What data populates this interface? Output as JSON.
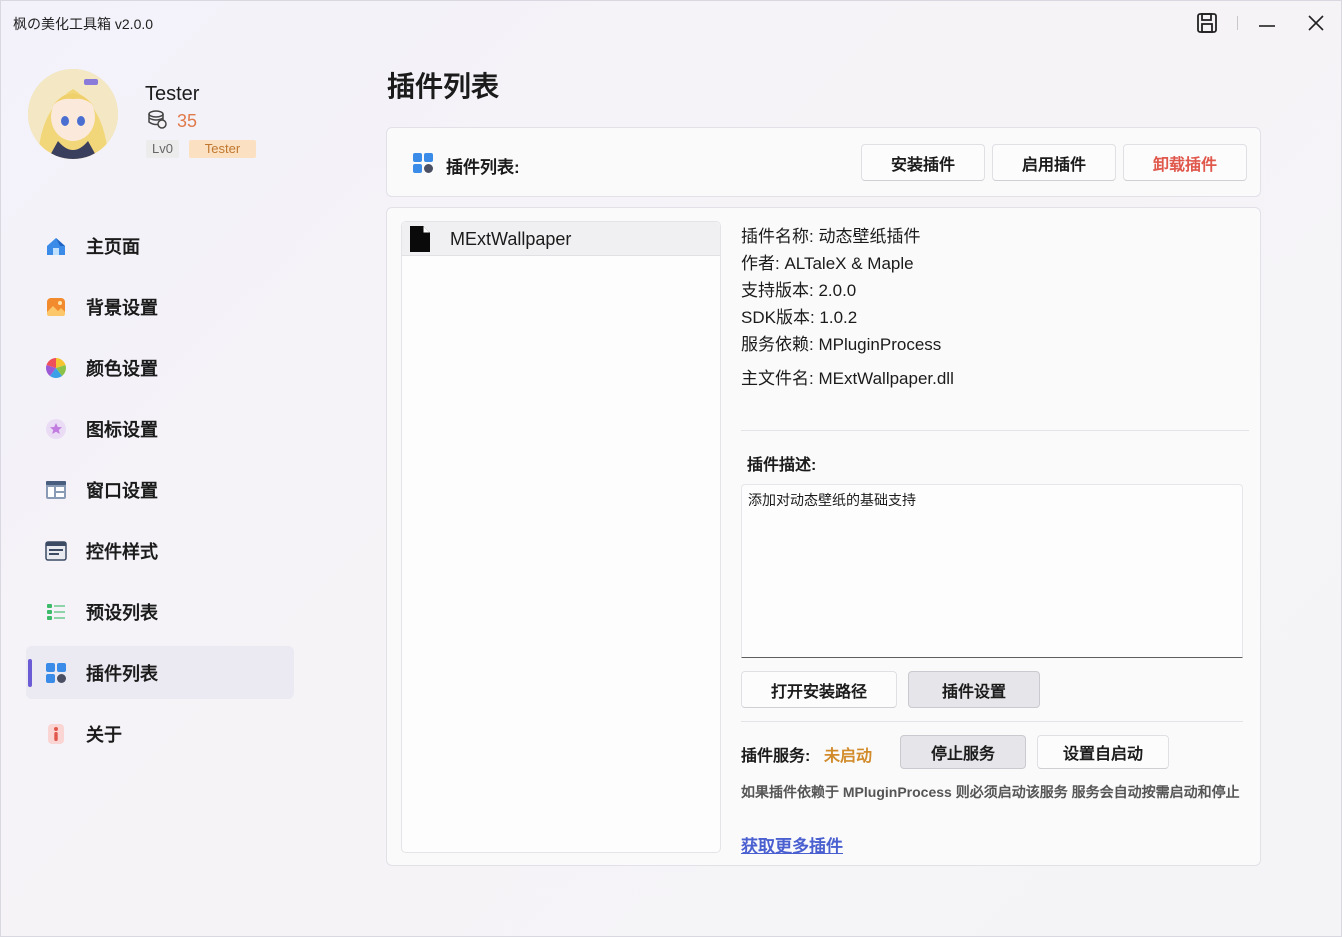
{
  "window": {
    "title": "枫の美化工具箱 v2.0.0",
    "buttons": [
      "save-icon",
      "minimize-icon",
      "close-icon"
    ]
  },
  "profile": {
    "username": "Tester",
    "coins": "35",
    "level": "Lv0",
    "role": "Tester"
  },
  "sidebar": {
    "items": [
      {
        "label": "主页面",
        "icon": "home-icon"
      },
      {
        "label": "背景设置",
        "icon": "image-icon"
      },
      {
        "label": "颜色设置",
        "icon": "color-wheel-icon"
      },
      {
        "label": "图标设置",
        "icon": "star-icon"
      },
      {
        "label": "窗口设置",
        "icon": "window-icon"
      },
      {
        "label": "控件样式",
        "icon": "control-icon"
      },
      {
        "label": "预设列表",
        "icon": "list-icon"
      },
      {
        "label": "插件列表",
        "icon": "plugin-grid-icon",
        "active": true
      },
      {
        "label": "关于",
        "icon": "info-icon"
      }
    ]
  },
  "main": {
    "title": "插件列表",
    "header_label": "插件列表:",
    "install_button": "安装插件",
    "enable_button": "启用插件",
    "uninstall_button": "卸载插件"
  },
  "plugins": [
    {
      "name": "MExtWallpaper",
      "selected": true
    }
  ],
  "details": {
    "name": "插件名称: 动态壁纸插件",
    "author": "作者: ALTaleX & Maple",
    "version": "支持版本: 2.0.0",
    "sdk": "SDK版本: 1.0.2",
    "dependency": "服务依赖: MPluginProcess",
    "main_file": "主文件名: MExtWallpaper.dll",
    "desc_label": "插件描述:",
    "description": "添加对动态壁纸的基础支持",
    "open_path_button": "打开安装路径",
    "settings_button": "插件设置",
    "service_label": "插件服务:",
    "service_status": "未启动",
    "stop_service_button": "停止服务",
    "autostart_button": "设置自启动",
    "hint": "如果插件依赖于 MPluginProcess 则必须启动该服务 服务会自动按需启动和停止",
    "more_link": "获取更多插件"
  },
  "colors": {
    "accent": "#6b5cd6",
    "danger": "#e0574b",
    "status_warning": "#d18b2b",
    "coin": "#e07a4a",
    "link": "#4a5fd0"
  }
}
